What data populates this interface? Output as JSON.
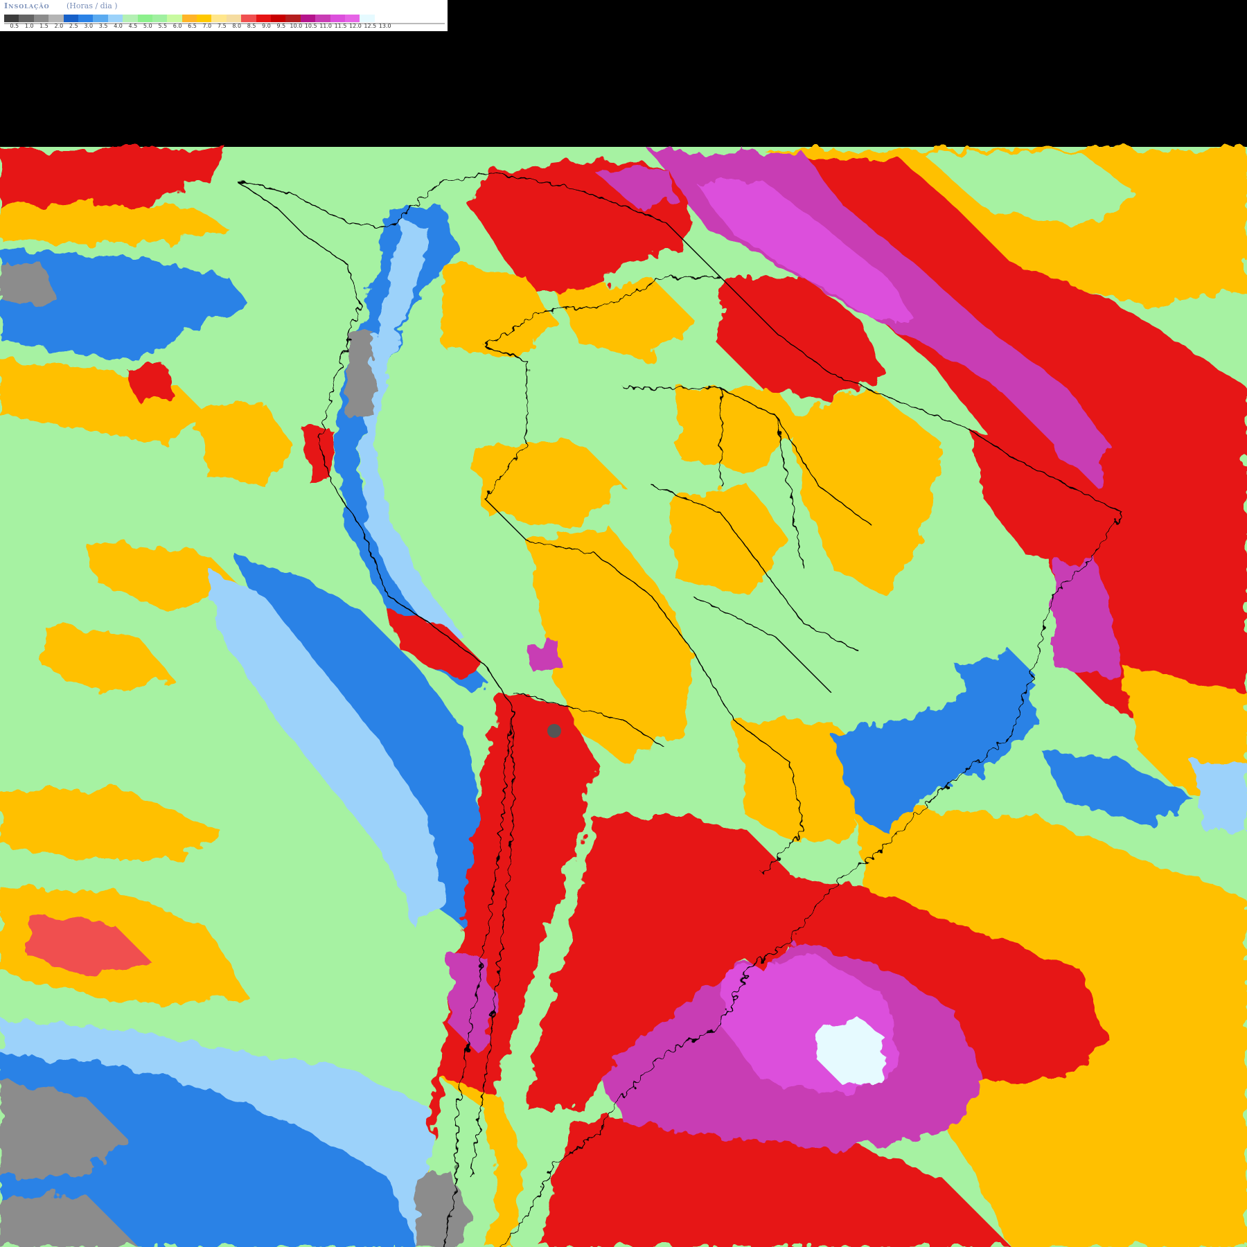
{
  "legend": {
    "title": "Insolação",
    "unit": "(Horas / dia )",
    "ticks": [
      "0.5",
      "1.0",
      "1.5",
      "2.0",
      "2.5",
      "3.0",
      "3.5",
      "4.0",
      "4.5",
      "5.0",
      "5.5",
      "6.0",
      "6.5",
      "7.0",
      "7.5",
      "8.0",
      "8.5",
      "9.0",
      "9.5",
      "10.0",
      "10.5",
      "11.0",
      "11.5",
      "12.0",
      "12.5",
      "13.0"
    ],
    "colors": [
      "#3c3c3c",
      "#646464",
      "#8c8c8c",
      "#b4b4b4",
      "#1760c8",
      "#2b82e6",
      "#5aaaf0",
      "#9cd2fa",
      "#b4f0b4",
      "#8cf08c",
      "#a0f0a0",
      "#c8faa0",
      "#ffb428",
      "#ffc800",
      "#ffe68c",
      "#f5dca0",
      "#f05050",
      "#e61414",
      "#c80000",
      "#b41e1e",
      "#b4148c",
      "#c83cb4",
      "#dc50dc",
      "#e664e6",
      "#e6faff",
      "#ffffff"
    ]
  },
  "palette": {
    "ocean_black": "#000000",
    "gray": "#8c8c8c",
    "blue": "#2b82e6",
    "light_blue": "#9cd2fa",
    "green": "#a0f0a0",
    "orange": "#ffc000",
    "red": "#e61414",
    "magenta": "#c83cb4",
    "pink": "#dc50dc",
    "white": "#e6faff",
    "border": "#000000"
  }
}
